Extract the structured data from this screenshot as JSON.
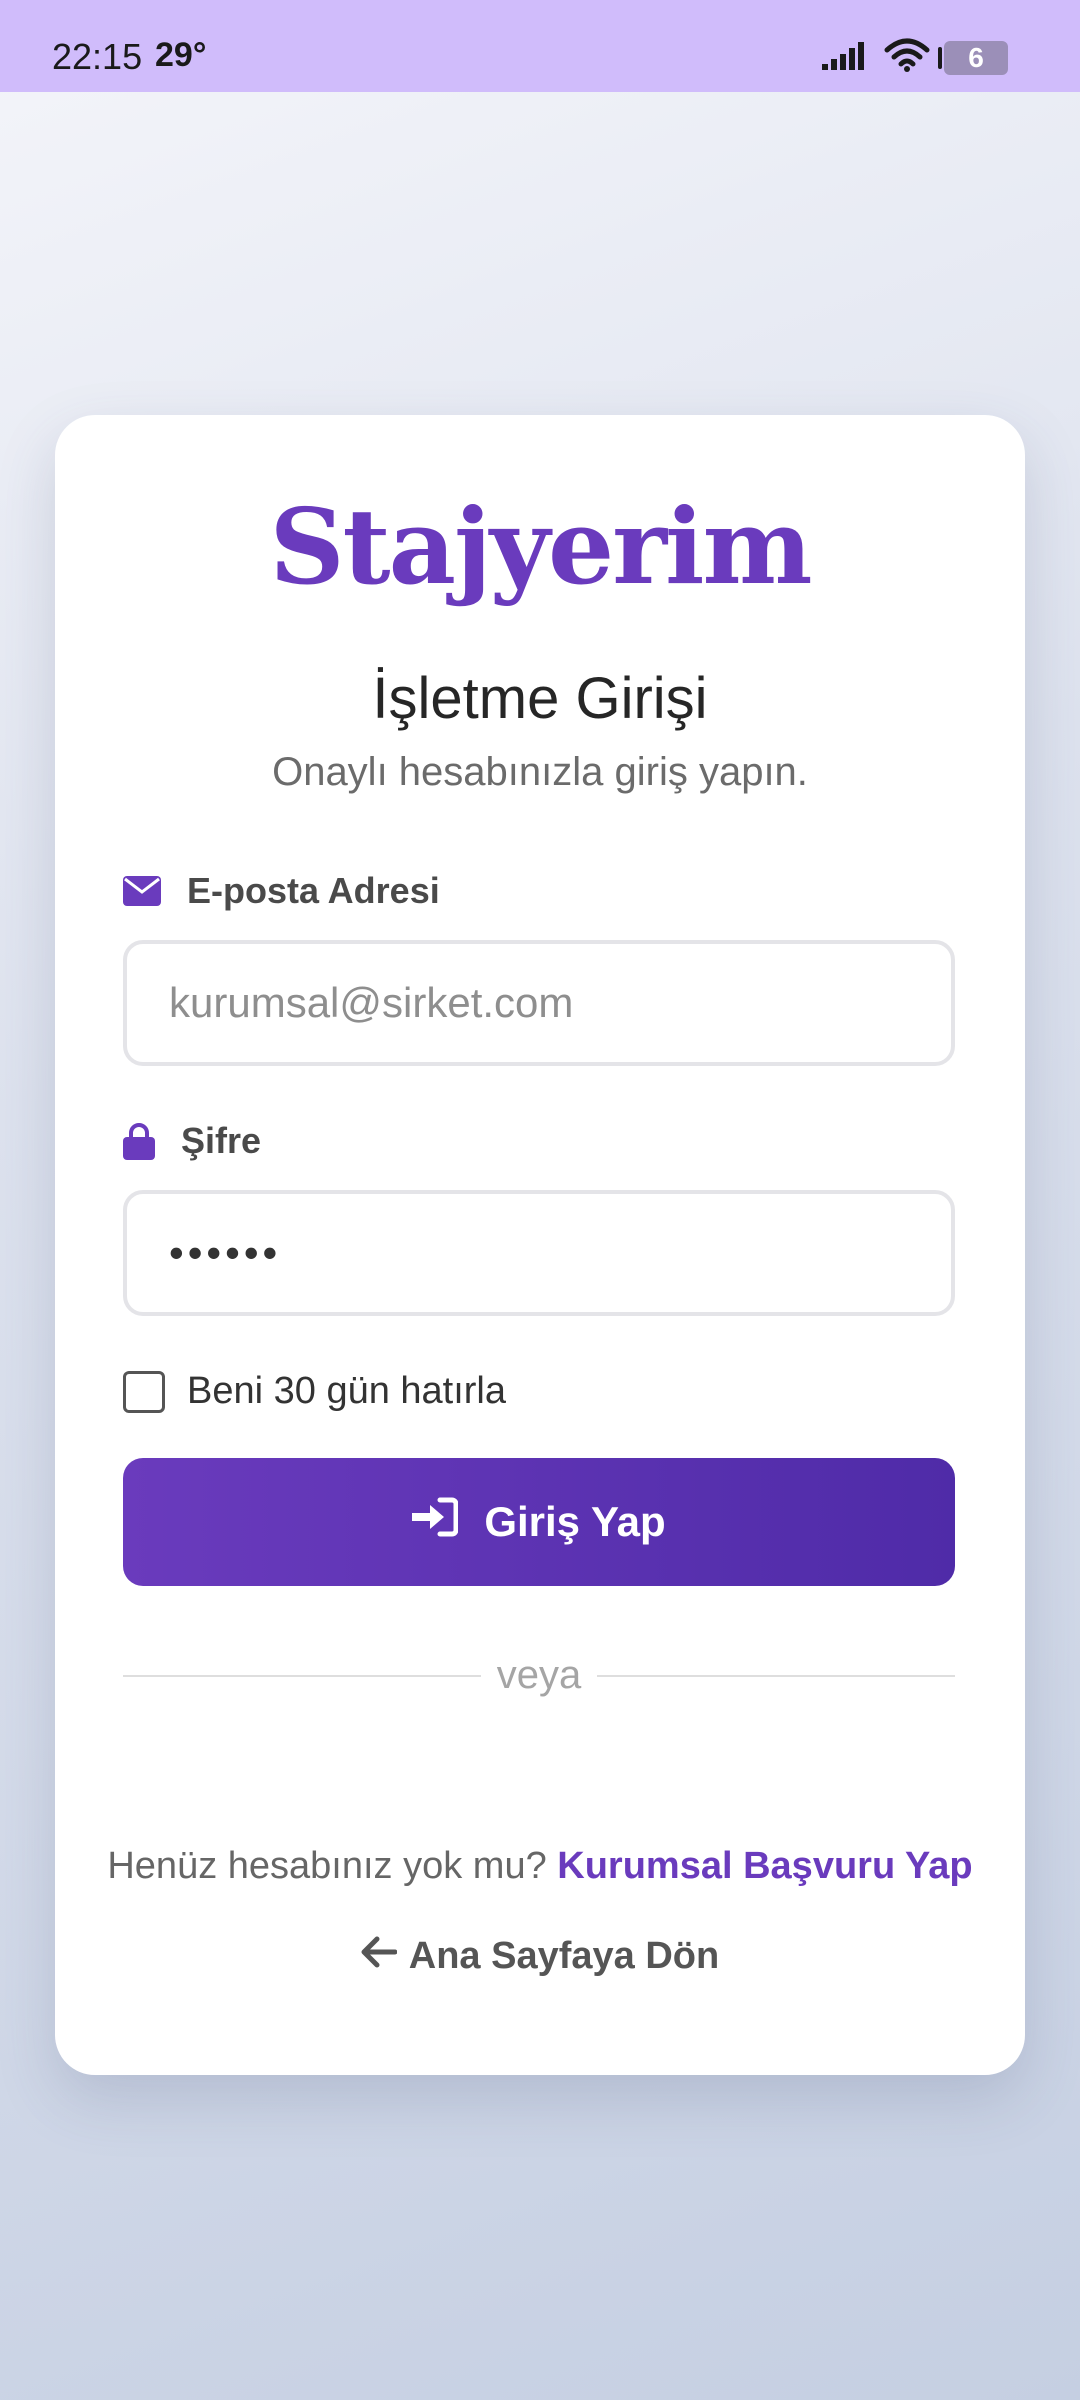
{
  "status_bar": {
    "time": "22:15",
    "temperature": "29°",
    "battery": "6"
  },
  "brand": {
    "logo_text": "Stajyerim",
    "color": "#6a3bbd"
  },
  "login": {
    "title": "İşletme Girişi",
    "subtitle": "Onaylı hesabınızla giriş yapın.",
    "email_label": "E-posta Adresi",
    "email_placeholder": "kurumsal@sirket.com",
    "password_label": "Şifre",
    "password_value": "••••••",
    "remember_label": "Beni 30 gün hatırla",
    "remember_checked": false,
    "submit_label": "Giriş Yap",
    "divider_text": "veya",
    "signup_prompt": "Henüz hesabınız yok mu?",
    "signup_link": "Kurumsal Başvuru Yap",
    "back_link": "Ana Sayfaya Dön"
  },
  "icons": {
    "email": "envelope-icon",
    "password": "lock-icon",
    "submit": "sign-in-icon",
    "back": "arrow-left-icon"
  }
}
